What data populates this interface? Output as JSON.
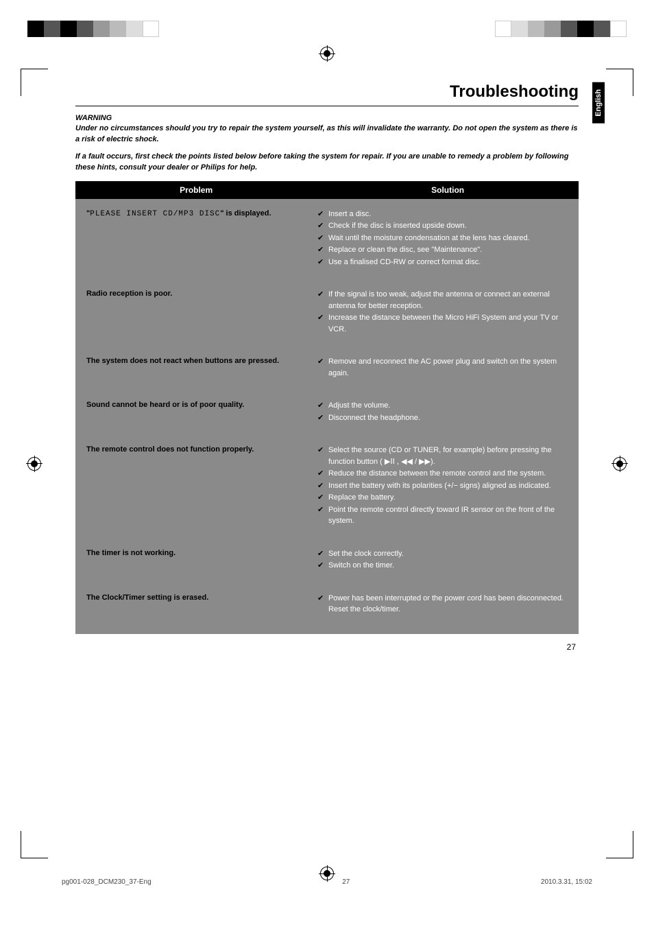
{
  "header": {
    "title": "Troubleshooting",
    "language_tab": "English"
  },
  "intro": {
    "warning_label": "WARNING",
    "para1": "Under no circumstances should you try to repair the system yourself, as this will invalidate the warranty.  Do not open the system as there is a risk of electric shock.",
    "para2": "If a fault occurs, first check the points listed below before taking the system for repair. If you are unable to remedy a problem by following these hints, consult your dealer or Philips for help."
  },
  "table": {
    "head_problem": "Problem",
    "head_solution": "Solution",
    "rows": [
      {
        "problem_prefix": "\"",
        "problem_lcd": "PLEASE INSERT CD/MP3 DISC",
        "problem_suffix": "\" is displayed.",
        "solutions": [
          "Insert a disc.",
          "Check if the disc is inserted upside down.",
          "Wait until the moisture condensation at the lens has cleared.",
          "Replace or clean the disc, see \"Maintenance\".",
          "Use a finalised CD-RW or correct format disc."
        ]
      },
      {
        "problem": "Radio reception is poor.",
        "solutions": [
          "If the signal is too weak, adjust the antenna or connect an external antenna for better reception.",
          "Increase the distance between the Micro HiFi System and your TV or VCR."
        ]
      },
      {
        "problem": "The system does not react when buttons are pressed.",
        "solutions": [
          "Remove and reconnect the AC power plug and switch on the system again."
        ]
      },
      {
        "problem": "Sound cannot be heard or is of poor quality.",
        "solutions": [
          "Adjust the volume.",
          "Disconnect the headphone."
        ]
      },
      {
        "problem": "The remote control does not function properly.",
        "solutions": [
          "Select the source (CD or TUNER, for example) before pressing the function button ( ▶ⅠⅠ , ◀◀ / ▶▶).",
          "Reduce the distance between the remote control and the system.",
          "Insert the battery with its polarities (+/− signs) aligned as indicated.",
          "Replace the battery.",
          "Point the remote control directly toward IR sensor on the front of the system."
        ]
      },
      {
        "problem": "The timer is not working.",
        "solutions": [
          "Set the clock correctly.",
          "Switch on the timer."
        ]
      },
      {
        "problem": "The Clock/Timer setting is erased.",
        "solutions": [
          "Power has been interrupted or the power cord has been disconnected. Reset the clock/timer."
        ]
      }
    ]
  },
  "page_number": "27",
  "footer": {
    "left": "pg001-028_DCM230_37-Eng",
    "mid": "27",
    "right": "2010.3.31, 15:02"
  }
}
